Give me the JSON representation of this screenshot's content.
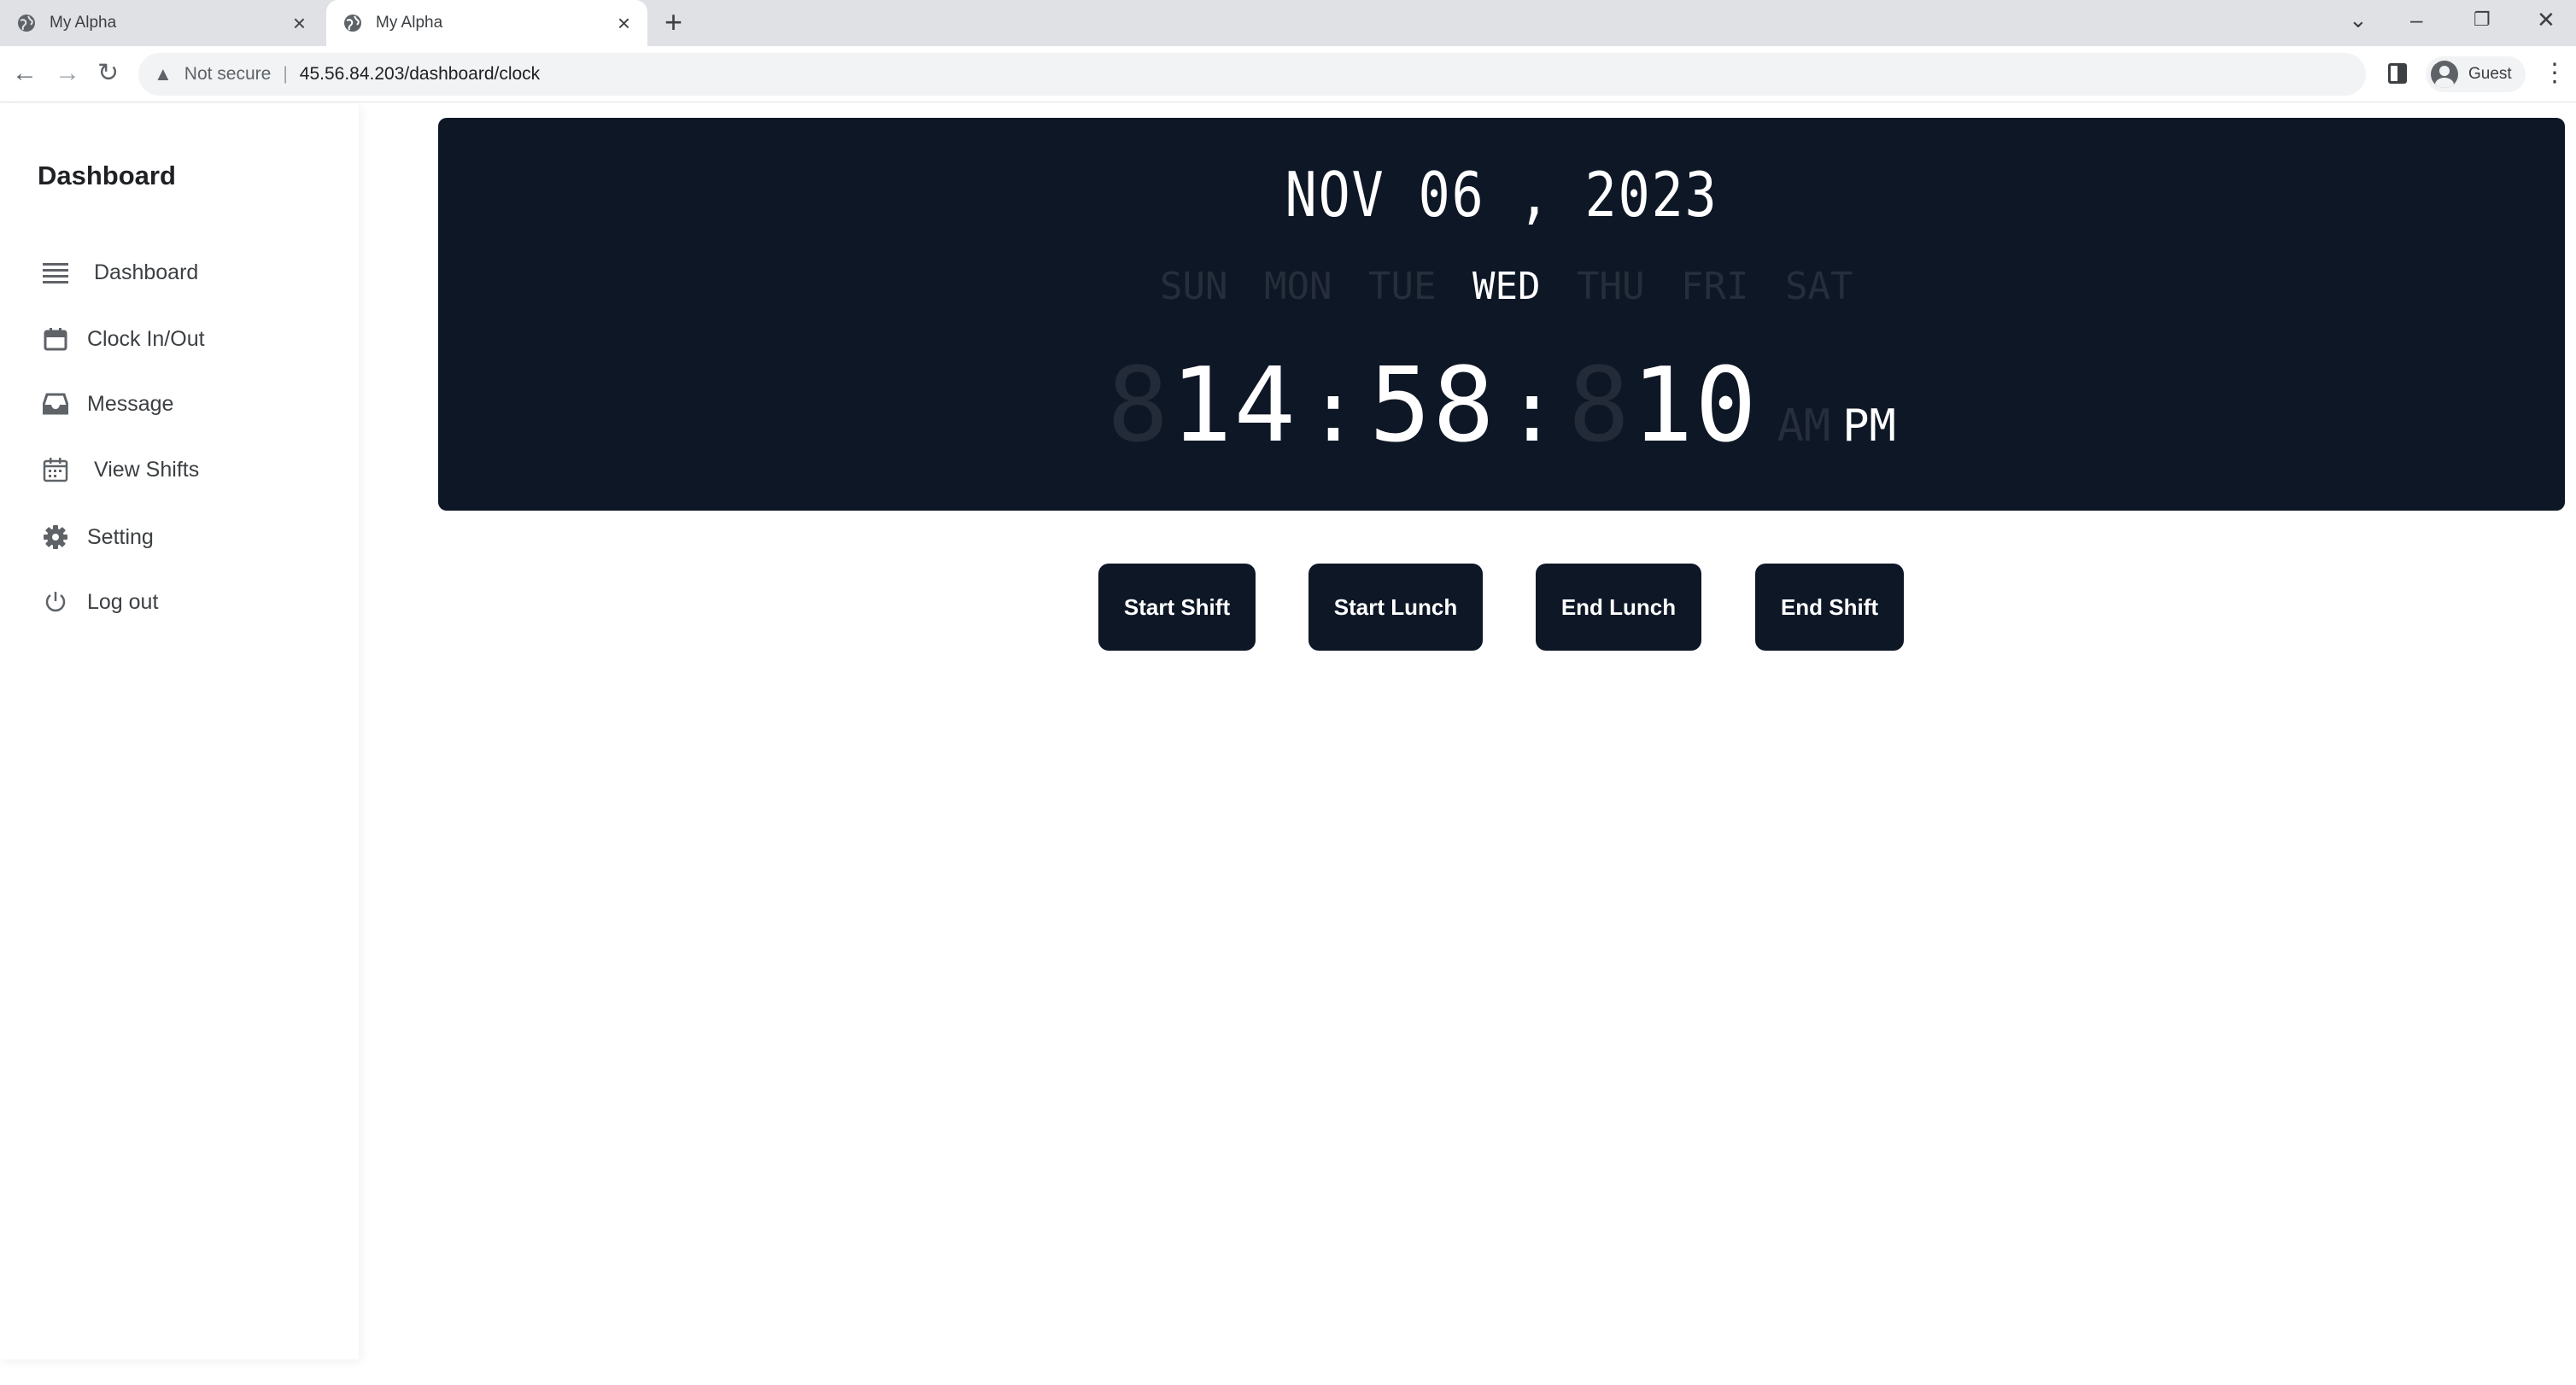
{
  "browser": {
    "tabs": [
      {
        "title": "My Alpha"
      },
      {
        "title": "My Alpha"
      }
    ],
    "address": {
      "security_text": "Not secure",
      "url": "45.56.84.203/dashboard/clock"
    },
    "profile_label": "Guest"
  },
  "sidebar": {
    "title": "Dashboard",
    "items": [
      {
        "label": "Dashboard",
        "icon": "list-icon"
      },
      {
        "label": "Clock In/Out",
        "icon": "calendar-icon"
      },
      {
        "label": "Message",
        "icon": "inbox-icon"
      },
      {
        "label": "View Shifts",
        "icon": "calendar-grid-icon"
      },
      {
        "label": "Setting",
        "icon": "gear-icon"
      },
      {
        "label": "Log out",
        "icon": "power-icon"
      }
    ]
  },
  "clock": {
    "date": "NOV 06 , 2023",
    "weekdays": [
      "SUN",
      "MON",
      "TUE",
      "WED",
      "THU",
      "FRI",
      "SAT"
    ],
    "active_weekday": "WED",
    "hours": "14",
    "minutes": "58",
    "seconds": "10",
    "ghost_digit": "8",
    "am_label": "AM",
    "pm_label": "PM",
    "active_period": "PM",
    "colors": {
      "panel": "#0e1726",
      "active": "#ffffff",
      "inactive": "#262e3b"
    }
  },
  "actions": {
    "start_shift": "Start Shift",
    "start_lunch": "Start Lunch",
    "end_lunch": "End Lunch",
    "end_shift": "End Shift"
  }
}
